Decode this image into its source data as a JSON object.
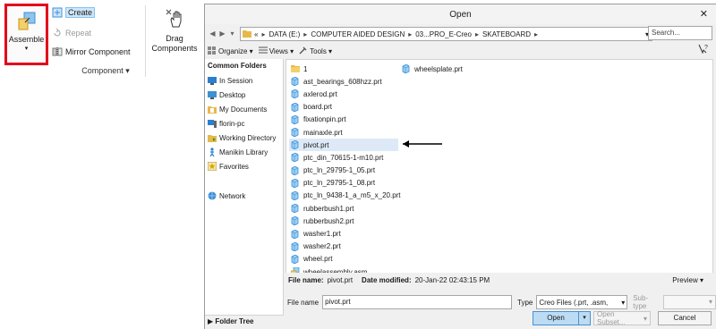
{
  "ribbon": {
    "assemble_label": "Assemble",
    "assemble_arrow": "▾",
    "create_label": "Create",
    "repeat_label": "Repeat",
    "mirror_label": "Mirror Component",
    "drag_label_1": "Drag",
    "drag_label_2": "Components",
    "group_label": "Component ▾"
  },
  "dialog": {
    "title": "Open",
    "close": "✕",
    "path": [
      "«",
      "DATA (E:)",
      "COMPUTER AIDED DESIGN",
      "03...PRO_E-Creo",
      "SKATEBOARD"
    ],
    "search_placeholder": "Search...",
    "toolbar": {
      "organize": "Organize ▾",
      "views": "Views ▾",
      "tools": "Tools ▾"
    },
    "help": "?",
    "left_pane": {
      "header": "Common Folders",
      "items": [
        "In Session",
        "Desktop",
        "My Documents",
        "florin-pc",
        "Working Directory",
        "Manikin Library",
        "Favorites"
      ],
      "network": "Network",
      "folder_tree": "Folder Tree"
    },
    "files_col1": [
      {
        "name": "1",
        "icon": "folder-icon"
      },
      {
        "name": "ast_bearings_608hzz.prt",
        "icon": "part-icon"
      },
      {
        "name": "axlerod.prt",
        "icon": "part-icon"
      },
      {
        "name": "board.prt",
        "icon": "part-icon"
      },
      {
        "name": "fixationpin.prt",
        "icon": "part-icon"
      },
      {
        "name": "mainaxle.prt",
        "icon": "part-icon"
      },
      {
        "name": "pivot.prt",
        "icon": "part-icon",
        "selected": true
      },
      {
        "name": "ptc_din_70615-1-m10.prt",
        "icon": "part-icon"
      },
      {
        "name": "ptc_ln_29795-1_05.prt",
        "icon": "part-icon"
      },
      {
        "name": "ptc_ln_29795-1_08.prt",
        "icon": "part-icon"
      },
      {
        "name": "ptc_ln_9438-1_a_m5_x_20.prt",
        "icon": "part-icon"
      },
      {
        "name": "rubberbush1.prt",
        "icon": "part-icon"
      },
      {
        "name": "rubberbush2.prt",
        "icon": "part-icon"
      },
      {
        "name": "washer1.prt",
        "icon": "part-icon"
      },
      {
        "name": "washer2.prt",
        "icon": "part-icon"
      },
      {
        "name": "wheel.prt",
        "icon": "part-icon"
      },
      {
        "name": "wheelassembly.asm",
        "icon": "assembly-icon"
      }
    ],
    "files_col2": [
      {
        "name": "wheelsplate.prt",
        "icon": "part-icon"
      }
    ],
    "info": {
      "file_name_label": "File name:",
      "file_name_value": "pivot.prt",
      "date_label": "Date modified:",
      "date_value": "20-Jan-22 02:43:15 PM",
      "preview": "Preview ▾"
    },
    "file_name_field_label": "File name",
    "file_name_field_value": "pivot.prt",
    "type_label": "Type",
    "type_value": "Creo Files (.prt, .asm,",
    "subtype_label": "Sub-type",
    "buttons": {
      "open": "Open",
      "open_dropdown": "▾",
      "open_subset": "Open Subset...",
      "open_subset_dropdown": "▾",
      "cancel": "Cancel"
    }
  },
  "colors": {
    "highlight_border": "#e3001b",
    "selected_row": "#dde9f6",
    "primary_button": "#bcdcf4",
    "part_icon": "#3d8fd6",
    "folder_icon": "#e8b84a"
  }
}
